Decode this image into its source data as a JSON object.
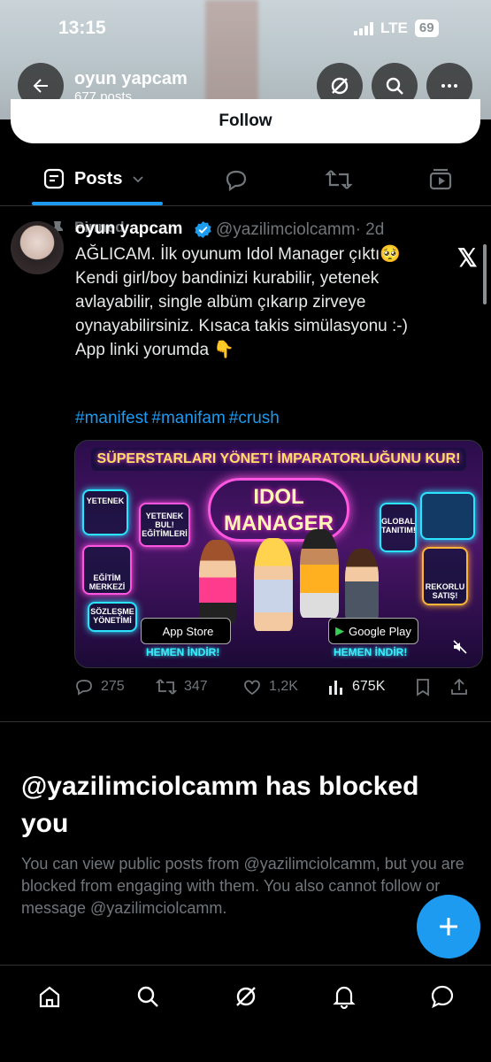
{
  "status_bar": {
    "time": "13:15",
    "network": "LTE",
    "battery": "69"
  },
  "header": {
    "title": "oyun yapcam",
    "subtitle": "677 posts"
  },
  "follow_button": {
    "label": "Follow"
  },
  "tabs": {
    "posts_label": "Posts"
  },
  "tweet": {
    "pinned_label": "Pinned",
    "author_name": "oyun yapcam",
    "author_handle": "@yazilimciolcamm",
    "time": "· 2d",
    "text": "AĞLICAM. İlk oyunum Idol Manager çıktı🥺\nKendi girl/boy bandinizi kurabilir, yetenek avlayabilir, single albüm çıkarıp zirveye oynayabilirsiniz.  Kısaca takis simülasyonu :-)\nApp linki yorumda  👇",
    "hashtags": [
      "#manifest",
      "#manifam",
      "#crush"
    ],
    "media": {
      "banner": "SÜPERSTARLARI YÖNET! İMPARATORLUĞUNU KUR!",
      "logo_line1": "IDOL",
      "logo_line2": "MANAGER",
      "panels": [
        "YETENEK",
        "YETENEK BUL! EĞİTİMLERİ",
        "EĞİTİM MERKEZİ",
        "SÖZLEŞME YÖNETİMİ",
        "GLOBAL TANITIM!",
        "REKORLU SATIŞ!"
      ],
      "app_store": "App Store",
      "google_play": "Google Play",
      "download_text": "HEMEN İNDİR!"
    },
    "replies": "275",
    "reposts": "347",
    "likes": "1,2K",
    "views": "675K"
  },
  "blocked": {
    "title": "@yazilimciolcamm has blocked you",
    "text": "You can view public posts from @yazilimciolcamm, but you are blocked from engaging with them. You also cannot follow or message @yazilimciolcamm."
  },
  "colors": {
    "accent": "#1d9bf0",
    "muted": "#71767b",
    "background": "#000000"
  }
}
